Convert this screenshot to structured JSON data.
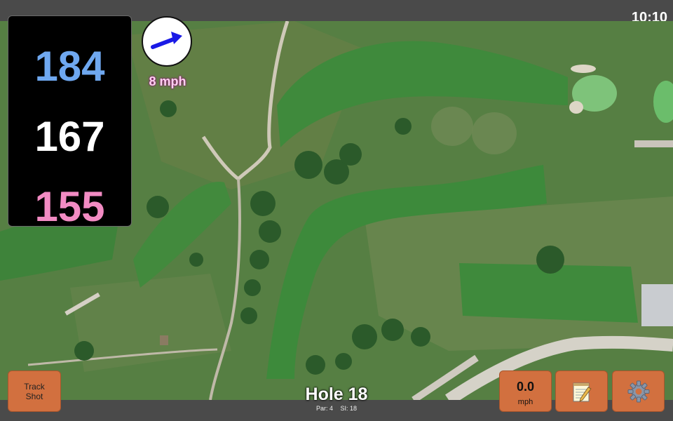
{
  "status": {
    "time": "10:10"
  },
  "distances": {
    "back": "184",
    "middle": "167",
    "front": "155"
  },
  "wind": {
    "speed_label": "8 mph",
    "direction_icon": "arrow-icon",
    "arrow_color": "#1a1ae6"
  },
  "hole": {
    "title": "Hole 18",
    "par_label": "Par: 4",
    "si_label": "SI: 18"
  },
  "buttons": {
    "track_shot_line1": "Track",
    "track_shot_line2": "Shot",
    "speed_value": "0.0",
    "speed_unit": "mph",
    "notes_icon": "notepad-icon",
    "settings_icon": "gear-icon"
  },
  "colors": {
    "button": "#d2703f",
    "back_distance": "#6fa8f0",
    "front_distance": "#f28bc3",
    "wind_label": "#ffd0f0"
  }
}
